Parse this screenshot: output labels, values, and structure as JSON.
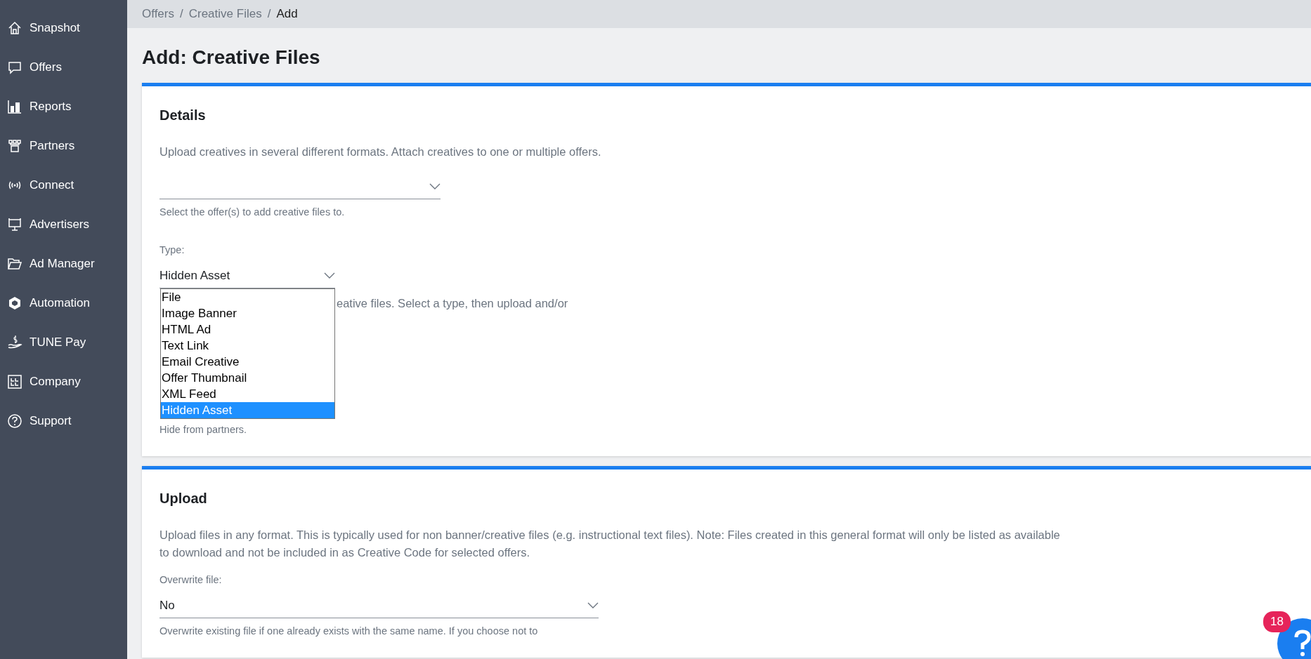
{
  "sidebar": {
    "items": [
      {
        "label": "Snapshot",
        "selected": false
      },
      {
        "label": "Offers",
        "selected": false
      },
      {
        "label": "Reports",
        "selected": false
      },
      {
        "label": "Partners",
        "selected": false
      },
      {
        "label": "Connect",
        "selected": false
      },
      {
        "label": "Advertisers",
        "selected": false
      },
      {
        "label": "Ad Manager",
        "selected": false
      },
      {
        "label": "Automation",
        "selected": false
      },
      {
        "label": "TUNE Pay",
        "selected": false
      },
      {
        "label": "Company",
        "selected": false
      },
      {
        "label": "Support",
        "selected": false
      }
    ]
  },
  "breadcrumb": [
    "Offers",
    "Creative Files",
    "Add"
  ],
  "breadcrumb_separator": "/",
  "page_title": "Add: Creative Files",
  "details": {
    "heading": "Details",
    "description": "Upload creatives in several different formats. Attach creatives to one or multiple offers.",
    "offer_select": {
      "help": "Select the offer(s) to add creative files to."
    },
    "type_select": {
      "label": "Type:",
      "value": "Hidden Asset",
      "expanded": true,
      "help_visible": "eative files. Select a type, then upload and/or",
      "options": [
        {
          "label": "File",
          "selected": false
        },
        {
          "label": "Image Banner",
          "selected": false
        },
        {
          "label": "HTML Ad",
          "selected": false
        },
        {
          "label": "Text Link",
          "selected": false
        },
        {
          "label": "Email Creative",
          "selected": false
        },
        {
          "label": "Offer Thumbnail",
          "selected": false
        },
        {
          "label": "XML Feed",
          "selected": false
        },
        {
          "label": "Hidden Asset",
          "selected": true
        }
      ]
    },
    "hidden_help": "Hide from partners."
  },
  "upload": {
    "heading": "Upload",
    "description": "Upload files in any format. This is typically used for non banner/creative files (e.g. instructional text files). Note: Files created in this general format will only be listed as available to download and not be included in as Creative Code for selected offers.",
    "overwrite": {
      "label": "Overwrite file:",
      "value": "No",
      "help": "Overwrite existing file if one already exists with the same name. If you choose not to"
    }
  },
  "help_button": {
    "badge": "18"
  }
}
